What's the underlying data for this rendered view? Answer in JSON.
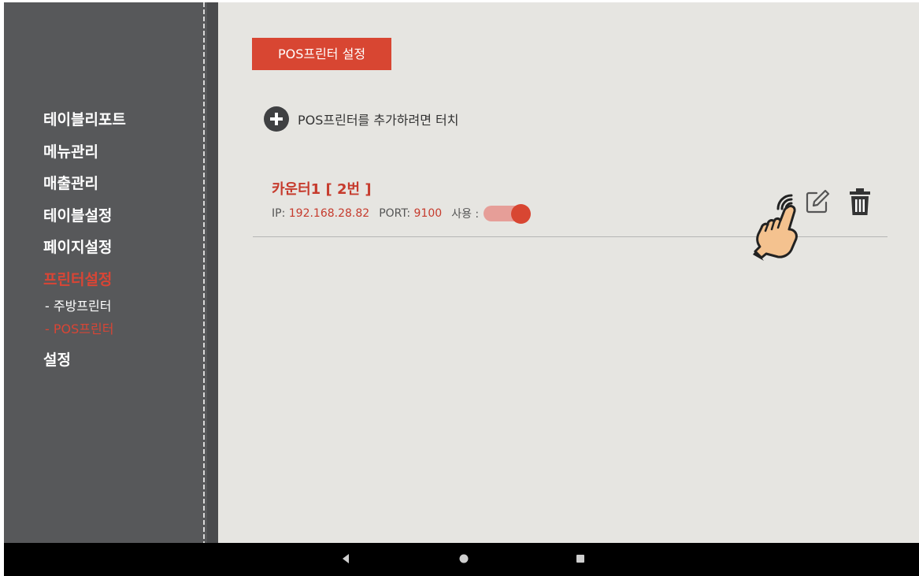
{
  "sidebar": {
    "items": [
      {
        "label": "테이블리포트"
      },
      {
        "label": "메뉴관리"
      },
      {
        "label": "매출관리"
      },
      {
        "label": "테이블설정"
      },
      {
        "label": "페이지설정"
      },
      {
        "label": "프린터설정",
        "active": true
      }
    ],
    "subitems": [
      {
        "label": "- 주방프린터"
      },
      {
        "label": "- POS프린터",
        "active": true
      }
    ],
    "last_item": {
      "label": "설정"
    }
  },
  "main": {
    "title": "POS프린터 설정",
    "add_label": "POS프린터를 추가하려면 터치",
    "printer": {
      "name": "카운터1 [ 2번 ]",
      "ip_label": "IP:",
      "ip_value": "192.168.28.82",
      "port_label": "PORT:",
      "port_value": "9100",
      "use_label": "사용 :",
      "use_enabled": true
    }
  },
  "icons": {
    "add": "plus-circle-icon",
    "edit": "edit-pencil-icon",
    "delete": "trash-icon",
    "pointer": "tap-hand-icon",
    "nav_back": "back-triangle-icon",
    "nav_home": "home-circle-icon",
    "nav_recent": "recent-square-icon"
  },
  "colors": {
    "accent": "#d84632",
    "sidebar": "#57585a",
    "background": "#e6e5e1",
    "toggle_track": "#e69e98"
  }
}
